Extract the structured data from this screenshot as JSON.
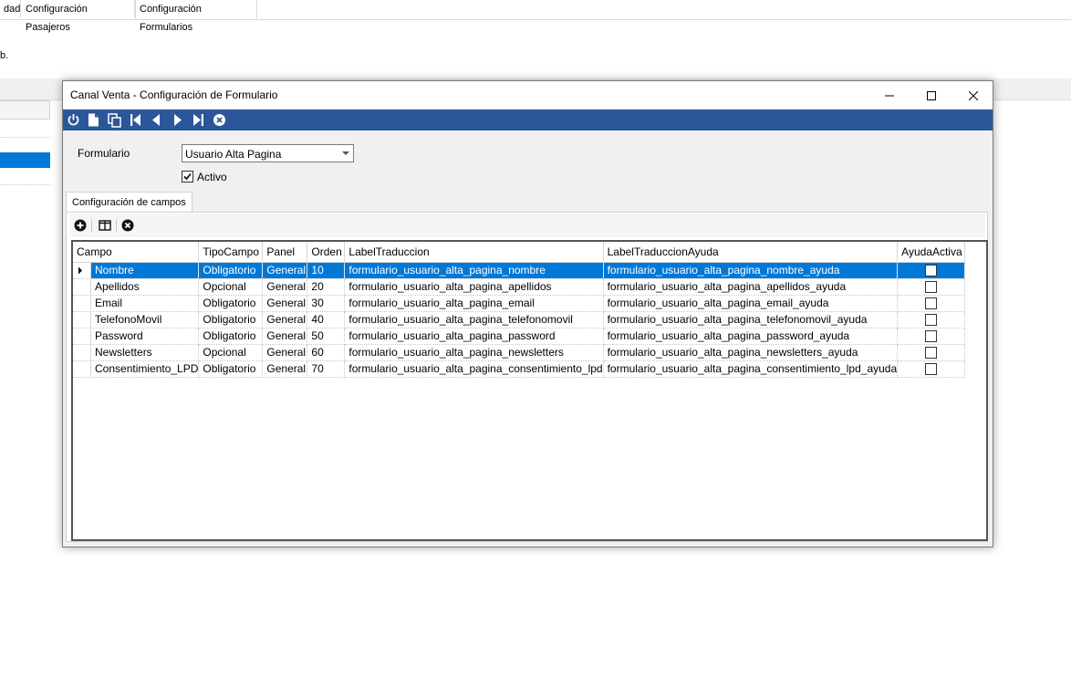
{
  "bg": {
    "tabs": [
      "dad",
      "Configuración Pasajeros",
      "Configuración Formularios"
    ],
    "text": "b."
  },
  "dialog": {
    "title": "Canal Venta - Configuración de Formulario",
    "window_controls": [
      "minimize-icon",
      "maximize-icon",
      "close-icon"
    ],
    "toolbar_icons": [
      "power-icon",
      "new-document-icon",
      "copy-icon",
      "first-record-icon",
      "previous-record-icon",
      "next-record-icon",
      "last-record-icon",
      "cancel-icon"
    ],
    "formulario_label": "Formulario",
    "formulario_value": "Usuario Alta Pagina",
    "activo_label": "Activo",
    "activo_checked": true,
    "tab_label": "Configuración de campos",
    "grid_toolbar_icons": [
      "add-icon",
      "columns-icon",
      "delete-icon"
    ],
    "grid": {
      "columns": [
        "Campo",
        "TipoCampo",
        "Panel",
        "Orden",
        "LabelTraduccion",
        "LabelTraduccionAyuda",
        "AyudaActiva"
      ],
      "rows": [
        {
          "campo": "Nombre",
          "tipo": "Obligatorio",
          "panel": "General",
          "orden": "10",
          "label": "formulario_usuario_alta_pagina_nombre",
          "ayuda": "formulario_usuario_alta_pagina_nombre_ayuda",
          "activa": false,
          "selected": true
        },
        {
          "campo": "Apellidos",
          "tipo": "Opcional",
          "panel": "General",
          "orden": "20",
          "label": "formulario_usuario_alta_pagina_apellidos",
          "ayuda": "formulario_usuario_alta_pagina_apellidos_ayuda",
          "activa": false
        },
        {
          "campo": "Email",
          "tipo": "Obligatorio",
          "panel": "General",
          "orden": "30",
          "label": "formulario_usuario_alta_pagina_email",
          "ayuda": "formulario_usuario_alta_pagina_email_ayuda",
          "activa": false
        },
        {
          "campo": "TelefonoMovil",
          "tipo": "Obligatorio",
          "panel": "General",
          "orden": "40",
          "label": "formulario_usuario_alta_pagina_telefonomovil",
          "ayuda": "formulario_usuario_alta_pagina_telefonomovil_ayuda",
          "activa": false
        },
        {
          "campo": "Password",
          "tipo": "Obligatorio",
          "panel": "General",
          "orden": "50",
          "label": "formulario_usuario_alta_pagina_password",
          "ayuda": "formulario_usuario_alta_pagina_password_ayuda",
          "activa": false
        },
        {
          "campo": "Newsletters",
          "tipo": "Opcional",
          "panel": "General",
          "orden": "60",
          "label": "formulario_usuario_alta_pagina_newsletters",
          "ayuda": "formulario_usuario_alta_pagina_newsletters_ayuda",
          "activa": false
        },
        {
          "campo": "Consentimiento_LPD",
          "tipo": "Obligatorio",
          "panel": "General",
          "orden": "70",
          "label": "formulario_usuario_alta_pagina_consentimiento_lpd",
          "ayuda": "formulario_usuario_alta_pagina_consentimiento_lpd_ayuda",
          "activa": false
        }
      ]
    }
  },
  "colors": {
    "toolbar": "#2b579a",
    "selection": "#0078d7"
  }
}
